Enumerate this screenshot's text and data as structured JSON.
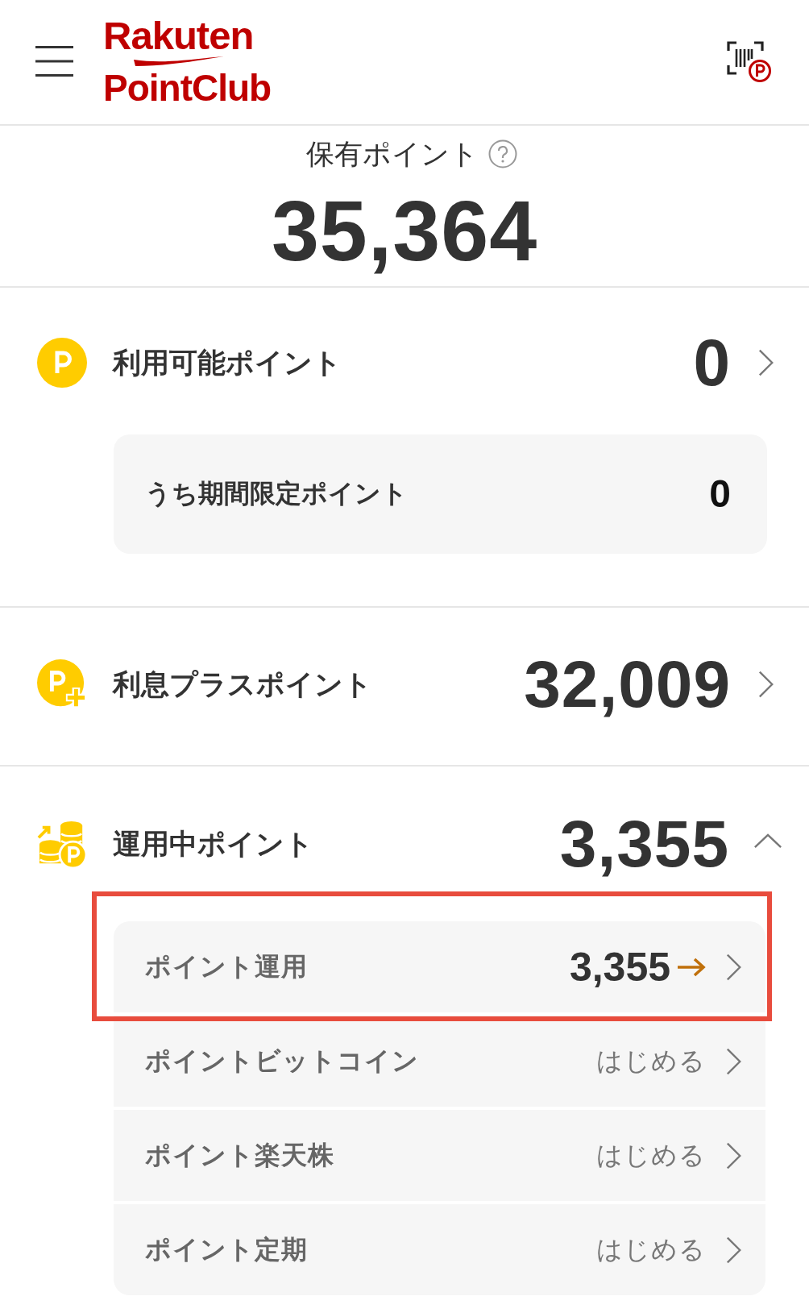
{
  "header": {
    "logo_line_1": "Rakuten",
    "logo_line_2": "PointClub"
  },
  "total": {
    "label": "保有ポイント",
    "value": "35,364"
  },
  "sections": [
    {
      "kind": "coin",
      "label": "利用可能ポイント",
      "value": "0",
      "detail": {
        "label": "うち期間限定ポイント",
        "value": "0"
      }
    },
    {
      "kind": "coin-plus",
      "label": "利息プラスポイント",
      "value": "32,009"
    },
    {
      "kind": "coins-growth",
      "label": "運用中ポイント",
      "value": "3,355",
      "expanded": true,
      "items": [
        {
          "kind": "amount",
          "label": "ポイント運用",
          "value": "3,355",
          "highlighted": true
        },
        {
          "kind": "start",
          "label": "ポイントビットコイン",
          "value": "はじめる",
          "highlighted": false
        },
        {
          "kind": "start",
          "label": "ポイント楽天株",
          "value": "はじめる",
          "highlighted": false
        },
        {
          "kind": "start",
          "label": "ポイント定期",
          "value": "はじめる",
          "highlighted": false
        }
      ]
    }
  ]
}
